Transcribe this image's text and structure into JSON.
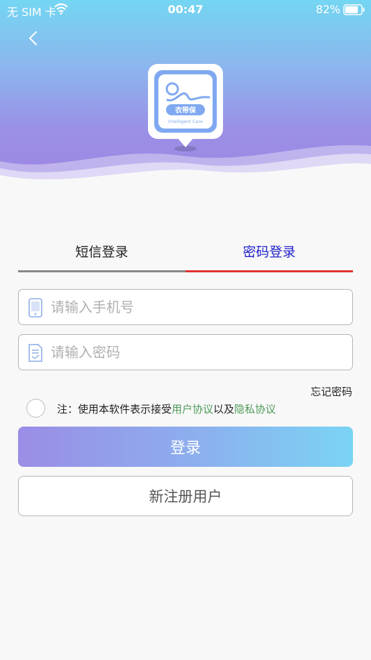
{
  "status_bar": {
    "carrier": "无 SIM 卡",
    "time": "00:47",
    "battery": "82%",
    "battery_level": 0.82
  },
  "logo": {
    "brand_text": "衣带保",
    "subtitle": "Intelligent Care"
  },
  "tabs": [
    {
      "label": "短信登录",
      "active": false
    },
    {
      "label": "密码登录",
      "active": true
    }
  ],
  "form": {
    "phone_placeholder": "请输入手机号",
    "password_placeholder": "请输入密码",
    "phone_value": "",
    "password_value": ""
  },
  "forgot_password": "忘记密码",
  "agreement": {
    "checked": false,
    "prefix": "注：使用本软件表示接受",
    "user_agreement": "用户协议",
    "connector": "以及",
    "privacy_agreement": "隐私协议"
  },
  "buttons": {
    "login": "登录",
    "register": "新注册用户"
  },
  "colors": {
    "active_tab_text": "#2222cc",
    "active_tab_underline": "#e0332f",
    "link": "#4e9a5a",
    "header_top": "#74d6f2",
    "header_bottom": "#a086e2"
  }
}
